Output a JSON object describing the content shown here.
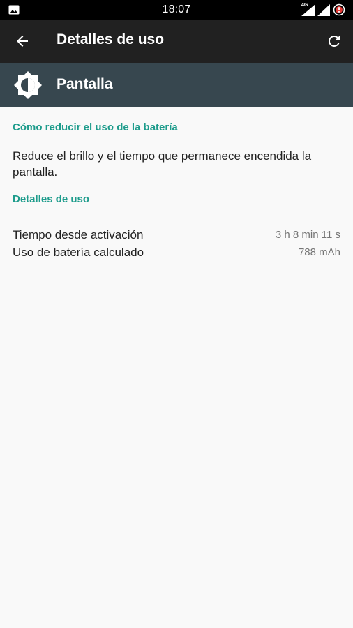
{
  "status_bar": {
    "time": "18:07",
    "network_label": "4G",
    "icons": [
      "image-icon",
      "signal-4g-icon",
      "signal-icon",
      "alert-icon"
    ]
  },
  "toolbar": {
    "title": "Detalles de uso",
    "back_icon": "arrow-back-icon",
    "refresh_icon": "refresh-icon"
  },
  "header": {
    "name": "Pantalla",
    "icon": "brightness-icon"
  },
  "tips": {
    "heading": "Cómo reducir el uso de la batería",
    "text": "Reduce el brillo y el tiempo que permanece encendida la pantalla."
  },
  "usage": {
    "heading": "Detalles de uso",
    "rows": [
      {
        "label": "Tiempo desde activación",
        "value": "3 h 8 min 11 s"
      },
      {
        "label": "Uso de batería calculado",
        "value": "788 mAh"
      }
    ]
  },
  "colors": {
    "accent": "#1e9c8c",
    "toolbar": "#212121",
    "header": "#37474f",
    "background": "#f9f9f9"
  }
}
